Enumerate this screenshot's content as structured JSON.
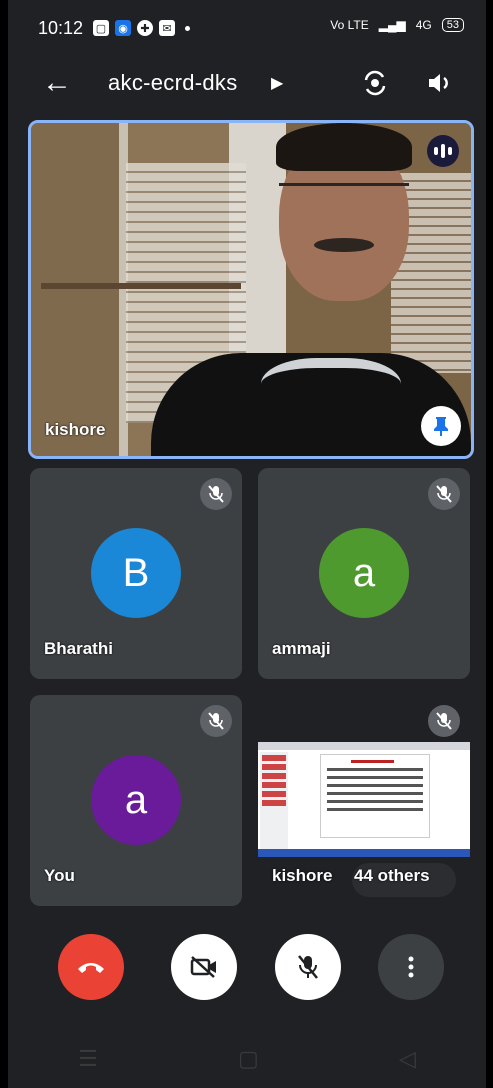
{
  "status_bar": {
    "time": "10:12",
    "network_label": "Vo LTE",
    "signal_label": "4G",
    "battery": "53"
  },
  "header": {
    "meeting_code": "akc-ecrd-dks"
  },
  "main_tile": {
    "name": "kishore"
  },
  "participants": [
    {
      "name": "Bharathi",
      "initial": "B",
      "color": "#1a88d6"
    },
    {
      "name": "ammaji",
      "initial": "a",
      "color": "#4f9a2e"
    },
    {
      "name": "You",
      "initial": "a",
      "color": "#6a1b9a"
    }
  ],
  "presentation_tile": {
    "name": "kishore",
    "others_label": "44 others"
  },
  "colors": {
    "accent": "#8ab4f8",
    "hangup": "#ea4335",
    "tile_bg": "#3c4043"
  }
}
